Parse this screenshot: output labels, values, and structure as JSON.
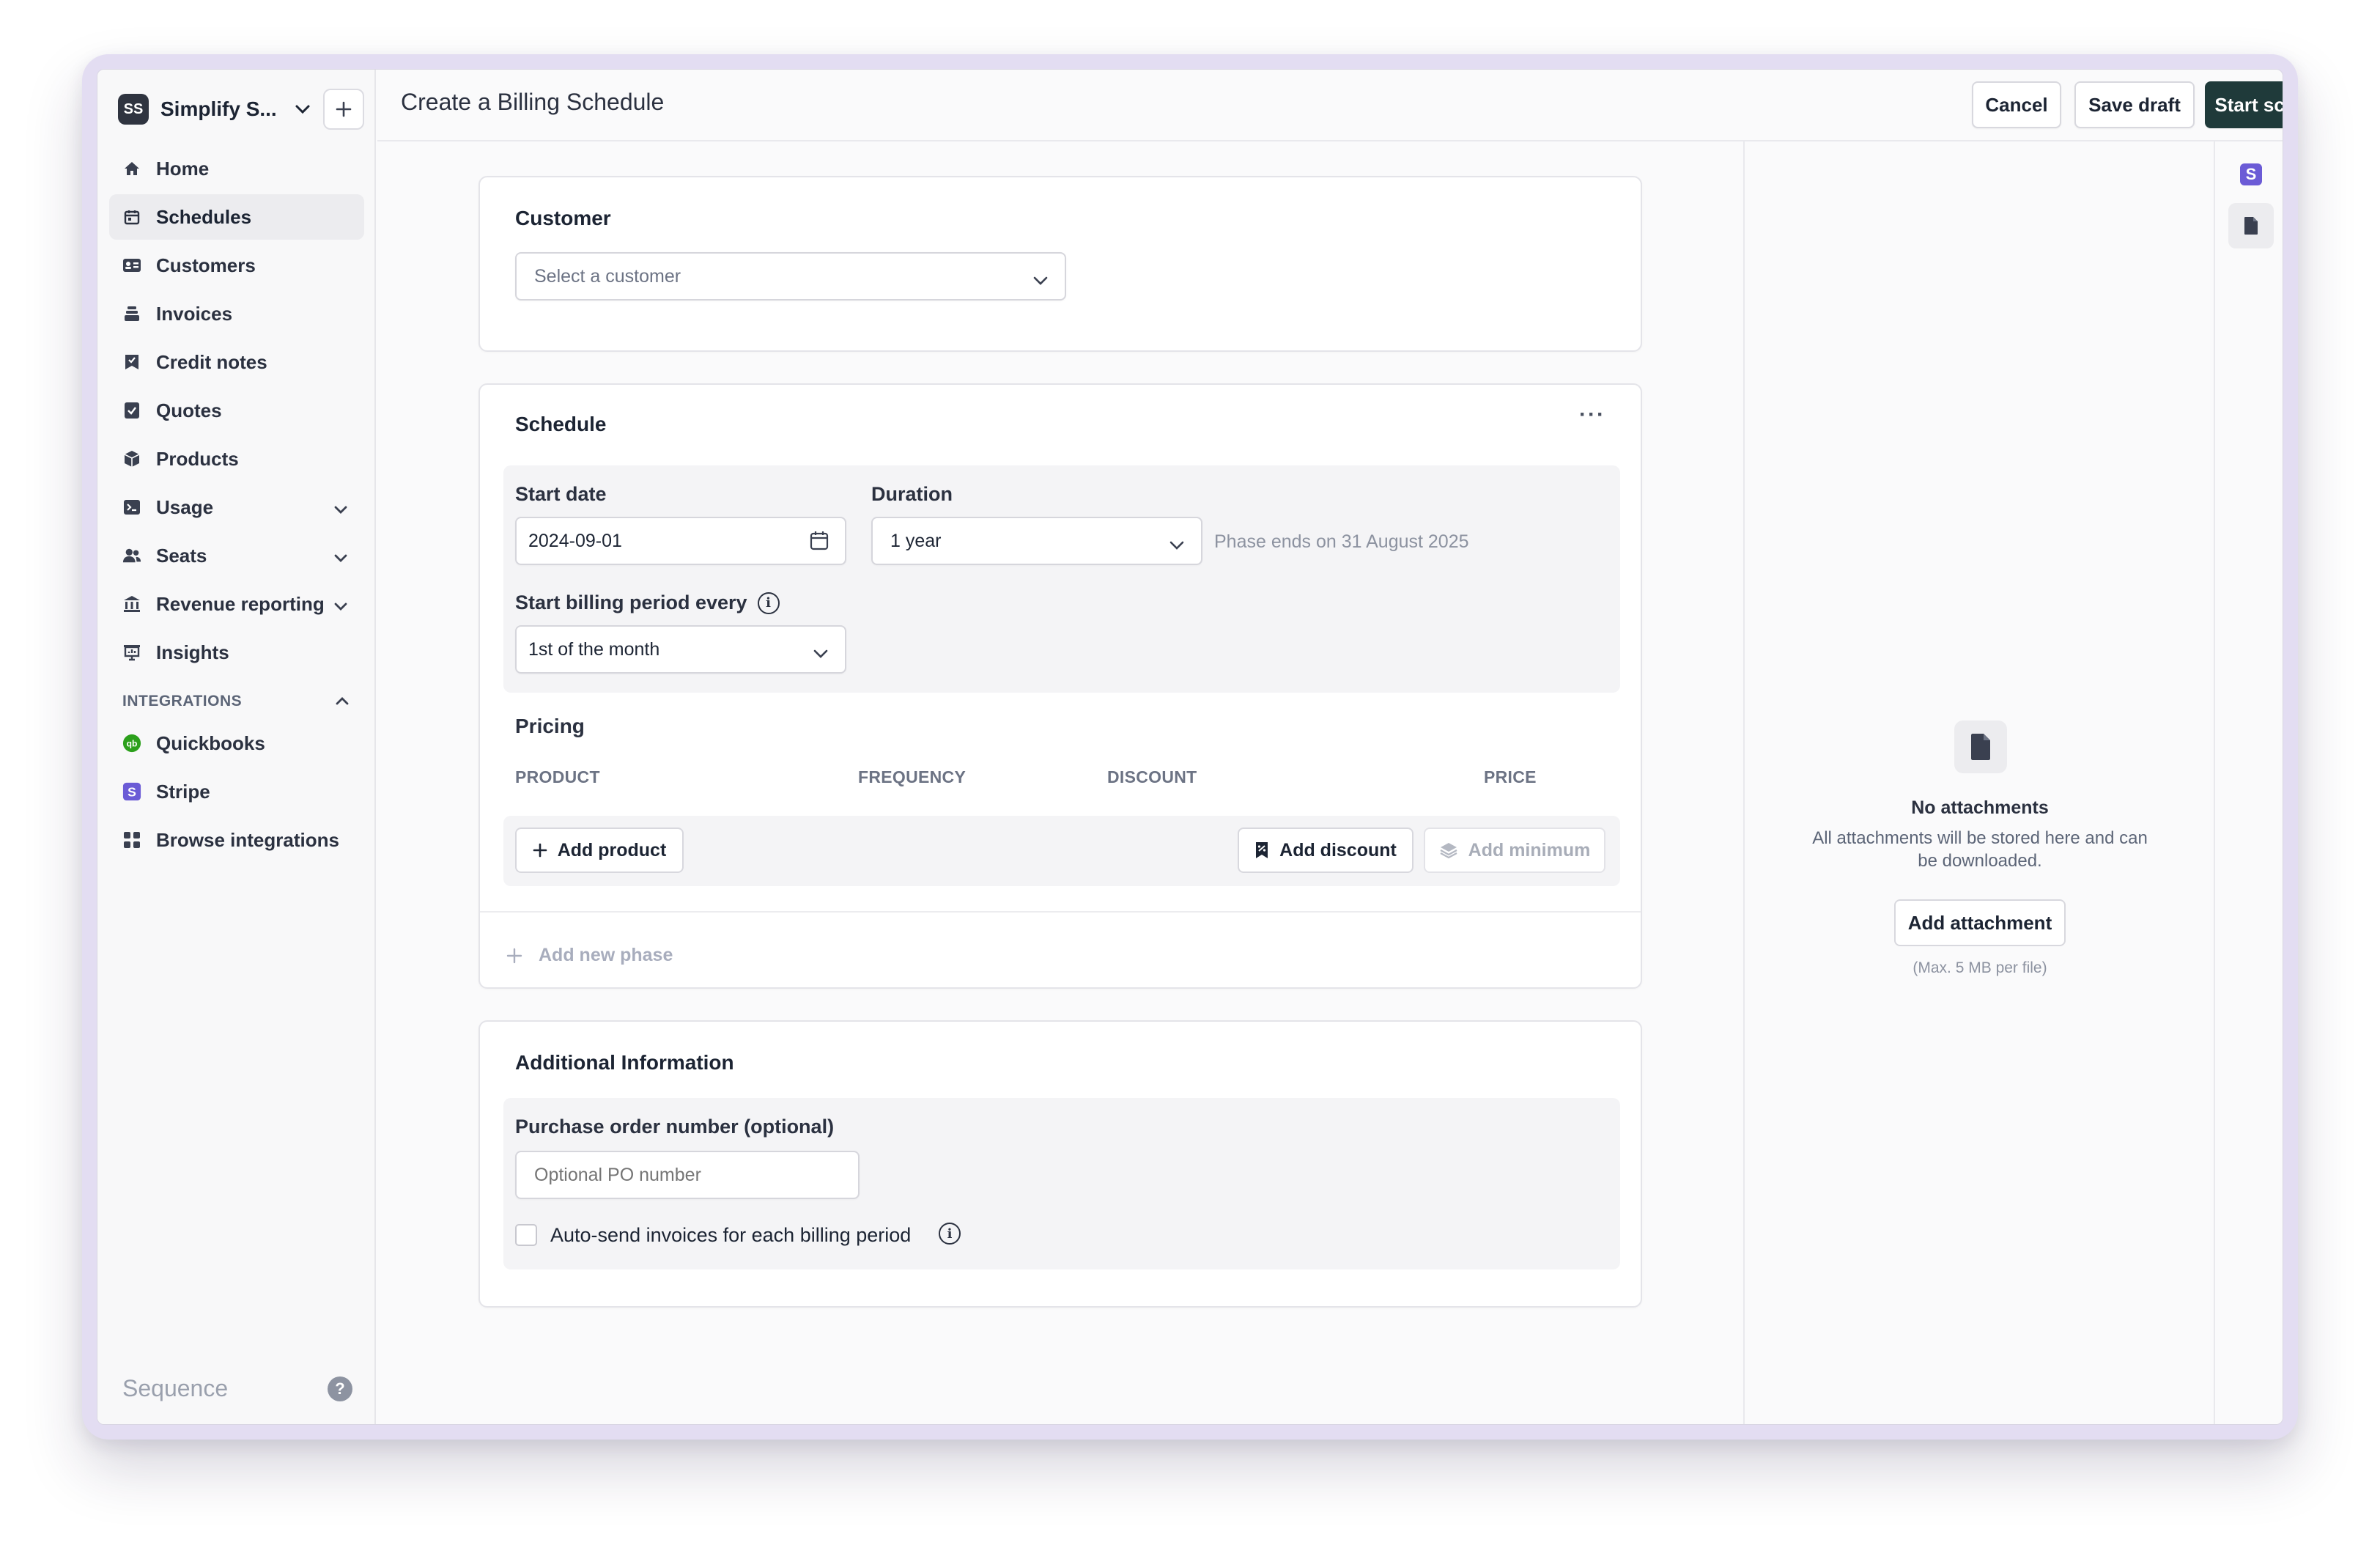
{
  "sidebar": {
    "org_initials": "SS",
    "org_name": "Simplify S...",
    "nav": [
      {
        "label": "Home",
        "icon": "home-icon"
      },
      {
        "label": "Schedules",
        "icon": "calendar-icon",
        "active": true
      },
      {
        "label": "Customers",
        "icon": "id-card-icon"
      },
      {
        "label": "Invoices",
        "icon": "stack-icon"
      },
      {
        "label": "Credit notes",
        "icon": "credit-note-icon"
      },
      {
        "label": "Quotes",
        "icon": "check-doc-icon"
      },
      {
        "label": "Products",
        "icon": "box-icon"
      },
      {
        "label": "Usage",
        "icon": "terminal-icon",
        "expandable": true
      },
      {
        "label": "Seats",
        "icon": "users-icon",
        "expandable": true
      },
      {
        "label": "Revenue reporting",
        "icon": "bank-icon",
        "expandable": true
      },
      {
        "label": "Insights",
        "icon": "presentation-icon"
      }
    ],
    "integrations_label": "INTEGRATIONS",
    "integrations": [
      {
        "label": "Quickbooks",
        "icon": "quickbooks-icon"
      },
      {
        "label": "Stripe",
        "icon": "stripe-icon"
      },
      {
        "label": "Browse integrations",
        "icon": "grid-icon"
      }
    ],
    "brand": "Sequence"
  },
  "header": {
    "title": "Create a Billing Schedule",
    "cancel": "Cancel",
    "save_draft": "Save draft",
    "start_schedule": "Start schedule"
  },
  "customer": {
    "title": "Customer",
    "select_placeholder": "Select a customer"
  },
  "schedule": {
    "title": "Schedule",
    "start_date_label": "Start date",
    "start_date_value": "2024-09-01",
    "duration_label": "Duration",
    "duration_value": "1 year",
    "phase_ends": "Phase ends on 31 August 2025",
    "billing_period_label": "Start billing period every",
    "billing_period_value": "1st of the month",
    "pricing_title": "Pricing",
    "columns": [
      "PRODUCT",
      "FREQUENCY",
      "DISCOUNT",
      "PRICE"
    ],
    "add_product": "Add product",
    "add_discount": "Add discount",
    "add_minimum": "Add minimum",
    "add_new_phase": "Add new phase"
  },
  "additional": {
    "title": "Additional Information",
    "po_label": "Purchase order number (optional)",
    "po_placeholder": "Optional PO number",
    "auto_send_label": "Auto-send invoices for each billing period"
  },
  "attachments": {
    "title": "No attachments",
    "description": "All attachments will be stored here and can be downloaded.",
    "button": "Add attachment",
    "note": "(Max. 5 MB per file)"
  },
  "colors": {
    "primary_button": "#1f3a3a",
    "stripe": "#6b5bd6",
    "quickbooks": "#2ca01c"
  }
}
